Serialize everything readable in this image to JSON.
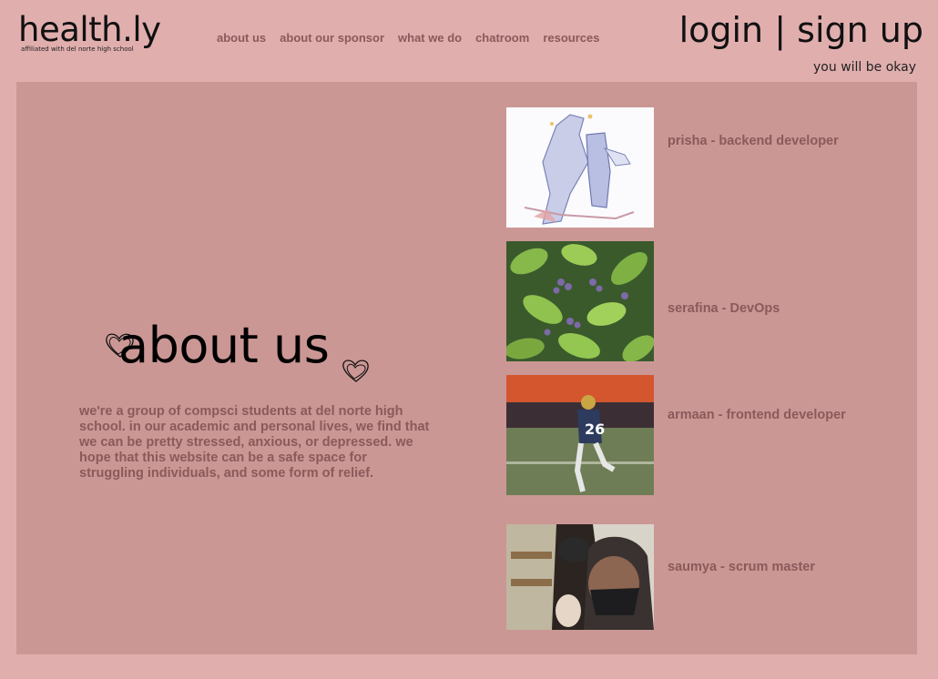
{
  "brand": {
    "title": "health.ly",
    "subtitle": "affiliated with del norte high school"
  },
  "nav": {
    "items": [
      "about us",
      "about our sponsor",
      "what we do",
      "chatroom",
      "resources"
    ]
  },
  "auth": {
    "login": "login",
    "separator": "|",
    "signup": "sign up"
  },
  "tagline": "you will be okay",
  "about": {
    "title": "about us",
    "body": "we're a group of compsci students at del norte high school. in our academic and personal lives, we find that we can be pretty stressed, anxious, or depressed. we hope that this website can be a safe space for struggling individuals, and some form of relief."
  },
  "team": [
    {
      "name": "prisha - backend developer",
      "photo": "anime-sketch-illustration"
    },
    {
      "name": "serafina - DevOps",
      "photo": "green-leaves-purple-flowers"
    },
    {
      "name": "armaan - frontend developer",
      "photo": "football-player-running"
    },
    {
      "name": "saumya - scrum master",
      "photo": "students-wearing-masks-selfie"
    }
  ],
  "colors": {
    "background": "#e1aeae",
    "panel": "#cb9795",
    "accent_text": "#8a5a5a",
    "text": "#111111"
  }
}
